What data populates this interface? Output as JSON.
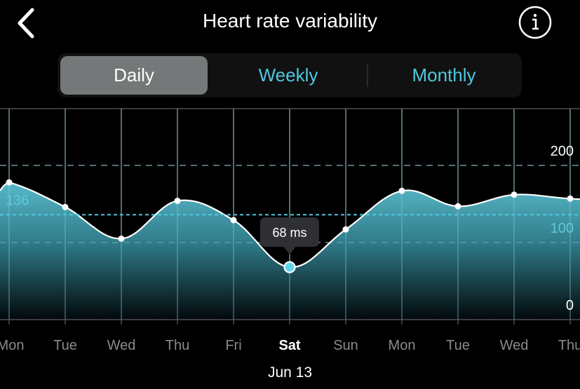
{
  "header": {
    "title": "Heart rate variability",
    "back_icon": "chevron-left-icon",
    "info_icon": "info-circle-icon"
  },
  "segmented_control": {
    "options": [
      {
        "label": "Daily",
        "active": true
      },
      {
        "label": "Weekly",
        "active": false
      },
      {
        "label": "Monthly",
        "active": false
      }
    ]
  },
  "colors": {
    "accent": "#4fc8e0",
    "area_top": "#4fb3c4",
    "active_segment": "#747878",
    "grid": "#3a3b3f",
    "tooltip_bg": "#2f3034"
  },
  "chart_data": {
    "type": "area",
    "title": "Heart rate variability",
    "categories": [
      "Mon",
      "Tue",
      "Wed",
      "Thu",
      "Fri",
      "Sat",
      "Sun",
      "Mon",
      "Tue",
      "Wed",
      "Thu"
    ],
    "values": [
      178,
      146,
      105,
      154,
      129,
      68,
      117,
      167,
      147,
      162,
      157
    ],
    "unit": "ms",
    "ylim": [
      0,
      200
    ],
    "yticks": [
      0,
      100,
      200
    ],
    "ytick_labels": [
      "0",
      "100",
      "200"
    ],
    "y_axis_side": "right",
    "grid": true,
    "average": {
      "value": 136,
      "label": "136"
    },
    "selected_index": 5,
    "tooltip": "68 ms",
    "selected_date": "Jun 13"
  }
}
